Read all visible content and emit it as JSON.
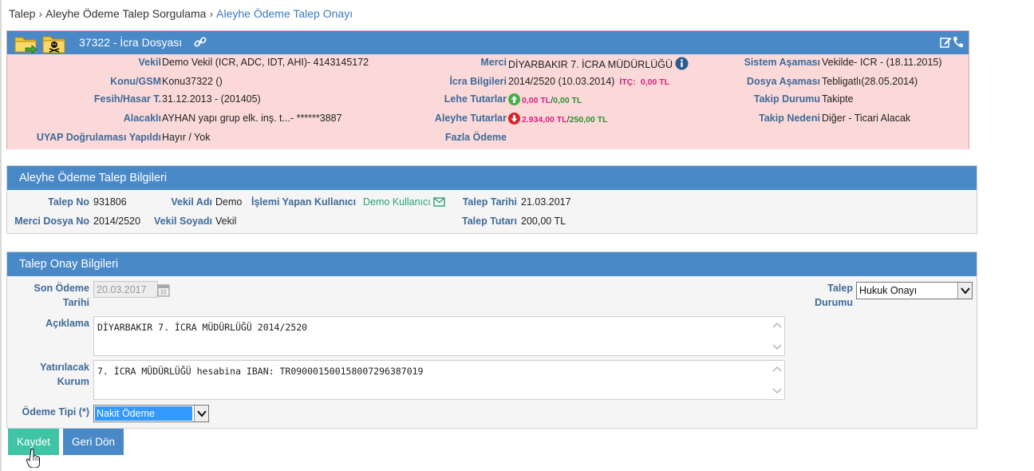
{
  "breadcrumb": {
    "items": [
      "Talep",
      "Aleyhe Ödeme Talep Sorgulama"
    ],
    "active": "Aleyhe Ödeme Talep Onayı",
    "separator": "›"
  },
  "file": {
    "title": "37322 - İcra Dosyası",
    "icons": [
      "folder-arrow-icon",
      "folder-skull-icon",
      "link-icon",
      "edit-icon",
      "phone-icon"
    ],
    "vekil_label": "Vekil",
    "vekil_value": "Demo Vekil  (ICR, ADC, IDT, AHI)- 4143145172",
    "konu_label": "Konu/GSM",
    "konu_value": "Konu37322 ()",
    "fesih_label": "Fesih/Hasar T.",
    "fesih_value": "31.12.2013 - (201405)",
    "alacakli_label": "Alacaklı",
    "alacakli_value": "AYHAN yapı grup elk. inş. t...- ******3887",
    "uyap_label": "UYAP Doğrulaması Yapıldı",
    "uyap_value": "Hayır / Yok",
    "merci_label": "Merci",
    "merci_value": "DİYARBAKIR 7. İCRA MÜDÜRLÜĞÜ",
    "icra_label": "İcra Bilgileri",
    "icra_value": "2014/2520 (10.03.2014)",
    "itc_label": "İTÇ:",
    "itc_value": "0,00 TL",
    "lehe_label": "Lehe Tutarlar",
    "lehe_pink": "0,00 TL",
    "lehe_green": "0,00 TL",
    "aleyhe_label": "Aleyhe Tutarlar",
    "aleyhe_pink": "2.934,00 TL",
    "aleyhe_green": "250,00 TL",
    "fazla_label": "Fazla Ödeme",
    "sistem_label": "Sistem Aşaması",
    "sistem_value": "Vekilde- ICR - (18.11.2015)",
    "dosya_label": "Dosya Aşaması",
    "dosya_value": "Tebligatlı(28.05.2014)",
    "takip_durumu_label": "Takip Durumu",
    "takip_durumu_value": "Takipte",
    "takip_nedeni_label": "Takip Nedeni",
    "takip_nedeni_value": "Diğer - Ticari Alacak",
    "slash": "/"
  },
  "talep_bilgileri": {
    "header": "Aleyhe Ödeme Talep Bilgileri",
    "talep_no_label": "Talep No",
    "talep_no_value": "931806",
    "merci_dosya_label": "Merci Dosya No",
    "merci_dosya_value": "2014/2520",
    "vekil_adi_label": "Vekil Adı",
    "vekil_adi_value": "Demo",
    "vekil_soyadi_label": "Vekil Soyadı",
    "vekil_soyadi_value": "Vekil",
    "islemi_yapan_label": "İşlemi Yapan Kullanıcı",
    "islemi_yapan_value": "Demo Kullanıcı",
    "talep_tarihi_label": "Talep Tarihi",
    "talep_tarihi_value": "21.03.2017",
    "talep_tutari_label": "Talep Tutarı",
    "talep_tutari_value": "200,00 TL"
  },
  "onay_bilgileri": {
    "header": "Talep Onay Bilgileri",
    "son_odeme_label_1": "Son Ödeme",
    "son_odeme_label_2": "Tarihi",
    "son_odeme_value": "20.03.2017",
    "aciklama_label": "Açıklama",
    "aciklama_value": "DİYARBAKIR 7. İCRA MÜDÜRLÜĞÜ 2014/2520",
    "yatirilacak_label_1": "Yatırılacak",
    "yatirilacak_label_2": "Kurum",
    "yatirilacak_value": "7. İCRA MÜDÜRLÜĞÜ hesabina IBAN: TR090001500158007296387019",
    "odeme_tipi_label": "Ödeme Tipi (*)",
    "odeme_tipi_value": "Nakit Ödeme",
    "talep_durumu_label_1": "Talep",
    "talep_durumu_label_2": "Durumu",
    "talep_durumu_value": "Hukuk Onayı"
  },
  "buttons": {
    "kaydet": "Kaydet",
    "geri_don": "Geri Dön"
  },
  "colors": {
    "header_blue": "#4a89c8",
    "pink_bg": "#fbd9d9",
    "label_blue": "#3f6a98",
    "save_green": "#40c4a6"
  }
}
